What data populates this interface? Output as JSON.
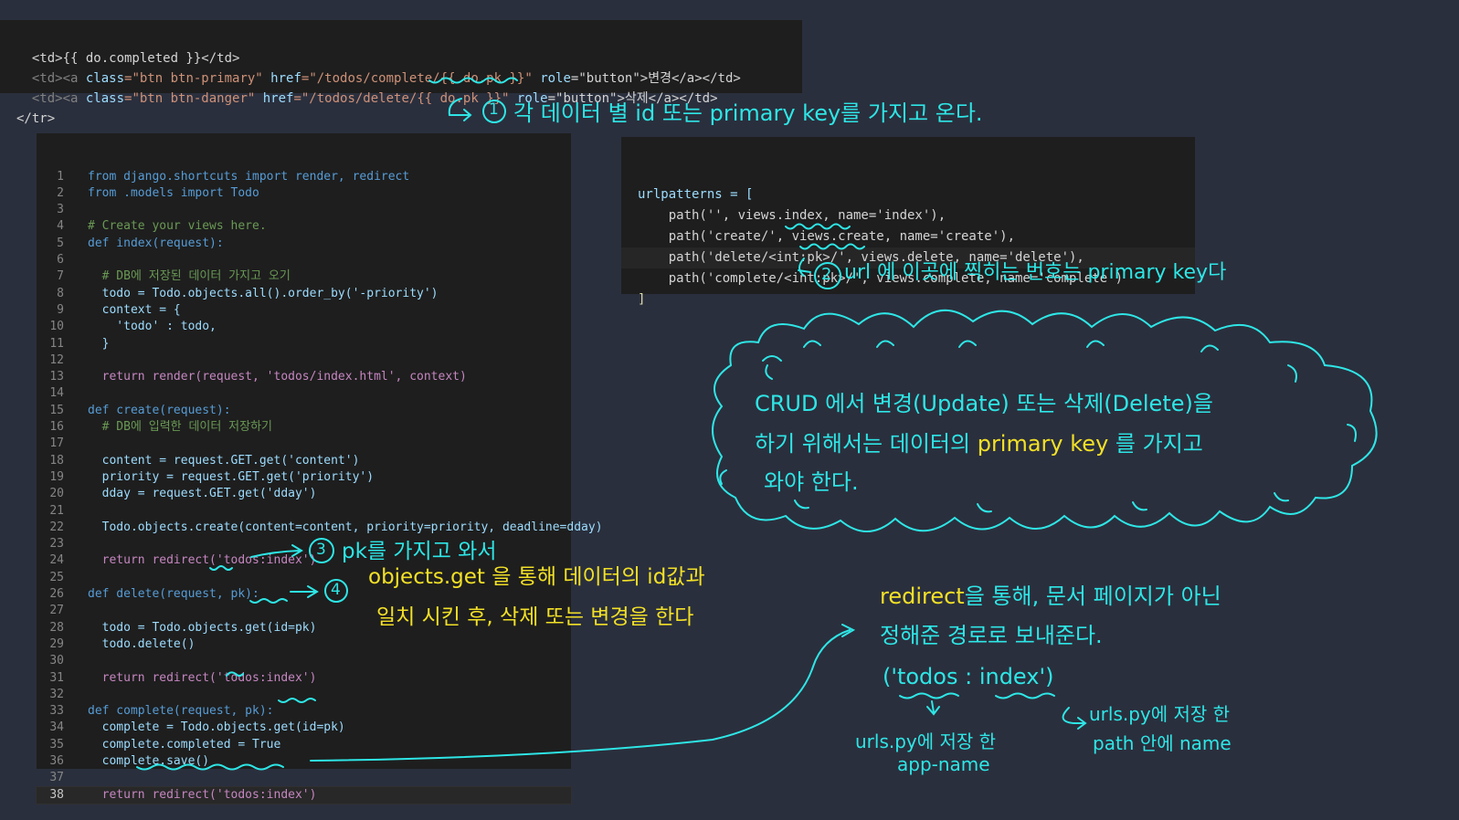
{
  "html_snippet": {
    "lines": [
      {
        "pre": "  <td>{{ do.completed }}</td>"
      },
      {
        "a1": "  <td><a ",
        "a2": "class",
        "a3": "=\"btn btn-primary\" ",
        "a4": "href",
        "a5": "=\"/todos/complete/{{ do.pk }}\" ",
        "a6": "role",
        "a7": "=\"button\">변경</a></td>"
      },
      {
        "a1": "  <td><a ",
        "a2": "class",
        "a3": "=\"btn btn-danger\" ",
        "a4": "href",
        "a5": "=\"/todos/delete/{{ do.pk }}\" ",
        "a6": "role",
        "a7": "=\"button\">삭제</a></td>"
      },
      {
        "pre": "</tr>"
      }
    ]
  },
  "views_code": {
    "lines": [
      {
        "n": "1",
        "t": "from django.shortcuts import render, redirect"
      },
      {
        "n": "2",
        "t": "from .models import Todo"
      },
      {
        "n": "3",
        "t": ""
      },
      {
        "n": "4",
        "t": "# Create your views here."
      },
      {
        "n": "5",
        "t": "def index(request):"
      },
      {
        "n": "6",
        "t": ""
      },
      {
        "n": "7",
        "t": "  # DB에 저장된 데이터 가지고 오기"
      },
      {
        "n": "8",
        "t": "  todo = Todo.objects.all().order_by('-priority')"
      },
      {
        "n": "9",
        "t": "  context = {"
      },
      {
        "n": "10",
        "t": "    'todo' : todo,"
      },
      {
        "n": "11",
        "t": "  }"
      },
      {
        "n": "12",
        "t": ""
      },
      {
        "n": "13",
        "t": "  return render(request, 'todos/index.html', context)"
      },
      {
        "n": "14",
        "t": ""
      },
      {
        "n": "15",
        "t": "def create(request):"
      },
      {
        "n": "16",
        "t": "  # DB에 입력한 데이터 저장하기"
      },
      {
        "n": "17",
        "t": ""
      },
      {
        "n": "18",
        "t": "  content = request.GET.get('content')"
      },
      {
        "n": "19",
        "t": "  priority = request.GET.get('priority')"
      },
      {
        "n": "20",
        "t": "  dday = request.GET.get('dday')"
      },
      {
        "n": "21",
        "t": ""
      },
      {
        "n": "22",
        "t": "  Todo.objects.create(content=content, priority=priority, deadline=dday)"
      },
      {
        "n": "23",
        "t": ""
      },
      {
        "n": "24",
        "t": "  return redirect('todos:index')"
      },
      {
        "n": "25",
        "t": ""
      },
      {
        "n": "26",
        "t": "def delete(request, pk):"
      },
      {
        "n": "27",
        "t": ""
      },
      {
        "n": "28",
        "t": "  todo = Todo.objects.get(id=pk)"
      },
      {
        "n": "29",
        "t": "  todo.delete()"
      },
      {
        "n": "30",
        "t": ""
      },
      {
        "n": "31",
        "t": "  return redirect('todos:index')"
      },
      {
        "n": "32",
        "t": ""
      },
      {
        "n": "33",
        "t": "def complete(request, pk):"
      },
      {
        "n": "34",
        "t": "  complete = Todo.objects.get(id=pk)"
      },
      {
        "n": "35",
        "t": "  complete.completed = True"
      },
      {
        "n": "36",
        "t": "  complete.save()"
      },
      {
        "n": "37",
        "t": ""
      },
      {
        "n": "38",
        "t": "  return redirect('todos:index')"
      }
    ]
  },
  "urls_code": {
    "lines": [
      "urlpatterns = [",
      "    path('', views.index, name='index'),",
      "    path('create/', views.create, name='create'),",
      "    path('delete/<int:pk>/', views.delete, name='delete'),",
      "    path('complete/<int:pk>/', views.complete, name='complete')",
      "]"
    ]
  },
  "annotations": {
    "note1": {
      "num": "1",
      "text": "각 데이터 별  id 또는  primary key를 가지고 온다."
    },
    "note2": {
      "num": "2",
      "text": "url 에 이곳에 찍히는 번호는 primary key다"
    },
    "cloud": {
      "line1": "CRUD 에서  변경(Update) 또는 삭제(Delete)을",
      "line2a": "하기 위해서는 데이터의",
      "line2b": "primary key",
      "line2c": "를 가지고",
      "line3": "와야 한다."
    },
    "note3": {
      "num": "3",
      "text": "pk를 가지고 와서"
    },
    "note4": {
      "num": "4",
      "line1": "objects.get 을 통해 데이터의 id값과",
      "line2": "일치 시킨 후, 삭제 또는 변경을 한다"
    },
    "redirect": {
      "word": "redirect",
      "line1rest": "을 통해, 문서 페이지가 아닌",
      "line2": "정해준 경로로 보내준다.",
      "example": "('todos : index')",
      "left_label1": "urls.py에 저장 한",
      "left_label2": "app-name",
      "right_label1": "urls.py에 저장 한",
      "right_label2": "path 안에 name"
    }
  },
  "colors": {
    "annotation": "#2ee6e6",
    "highlight": "#f2e027"
  }
}
